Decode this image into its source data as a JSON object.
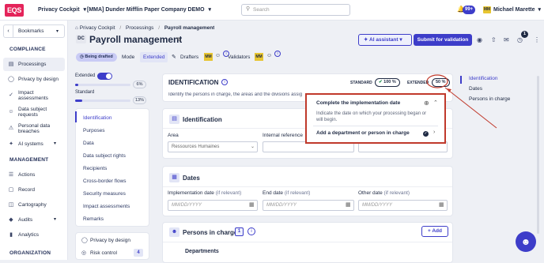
{
  "colors": {
    "accent": "#3d3dc9",
    "brand": "#e4245a",
    "status": "#1c8a4a"
  },
  "topbar": {
    "logo": "EQS",
    "product_select": "Privacy Cockpit",
    "company_select": "[MMA] Dunder Mifflin Paper Company DEMO",
    "search_placeholder": "Search",
    "notifications_badge": "99+",
    "user_initials": "MM",
    "user_name": "Michael Marette"
  },
  "sidebar": {
    "bookmarks": "Bookmarks",
    "sections": [
      {
        "title": "COMPLIANCE",
        "items": [
          {
            "label": "Processings",
            "icon": "document-icon",
            "active": true
          },
          {
            "label": "Privacy by design",
            "icon": "shield-icon"
          },
          {
            "label": "Impact assessments",
            "icon": "shield-check-icon"
          },
          {
            "label": "Data subject requests",
            "icon": "person-icon"
          },
          {
            "label": "Personal data breaches",
            "icon": "warning-icon"
          },
          {
            "label": "AI systems",
            "icon": "ai-icon",
            "expandable": true
          }
        ]
      },
      {
        "title": "MANAGEMENT",
        "items": [
          {
            "label": "Actions",
            "icon": "actions-icon"
          },
          {
            "label": "Record",
            "icon": "record-icon"
          },
          {
            "label": "Cartography",
            "icon": "map-icon"
          },
          {
            "label": "Audits",
            "icon": "audit-icon",
            "expandable": true
          },
          {
            "label": "Analytics",
            "icon": "analytics-icon"
          }
        ]
      },
      {
        "title": "ORGANIZATION",
        "items": []
      }
    ]
  },
  "breadcrumb": {
    "items": [
      "Privacy Cockpit",
      "Processings",
      "Payroll management"
    ],
    "separator": "/"
  },
  "header": {
    "avatar_initials": "DC",
    "title": "Payroll management",
    "status": "Being drafted",
    "mode_label": "Mode",
    "mode_value": "Extended",
    "drafters_label": "Drafters",
    "drafter_initials": "MM",
    "validators_label": "Validators",
    "validator_initials": "MM",
    "ai_button": "AI assistant",
    "submit_button": "Submit for validation",
    "counter_badge": "1"
  },
  "progress": {
    "extended_label": "Extended",
    "extended_percent": "6%",
    "extended_value": 0.06,
    "standard_label": "Standard",
    "standard_percent": "13%",
    "standard_value": 0.13
  },
  "section_nav": [
    "Identification",
    "Purposes",
    "Data",
    "Data subject rights",
    "Recipients",
    "Cross-border flows",
    "Security measures",
    "Impact assessments",
    "Remarks"
  ],
  "bottom_nav": [
    {
      "label": "Privacy by design"
    },
    {
      "label": "Risk control",
      "count": "4"
    }
  ],
  "identification": {
    "title": "IDENTIFICATION",
    "description": "Identify the persons in charge, the areas and the divisions assig",
    "standard_label": "STANDARD",
    "standard_pct": "100 %",
    "extended_label": "EXTENDED",
    "extended_pct": "50 %"
  },
  "popup": {
    "item1_title": "Complete the implementation date",
    "item1_desc": "Indicate the date on which your processing began or will begin.",
    "item2_title": "Add a department or person in charge"
  },
  "identification_card": {
    "title": "Identification",
    "area_label": "Area",
    "area_value": "Ressources Humaines",
    "internal_ref_label": "Internal reference"
  },
  "dates_card": {
    "title": "Dates",
    "impl_label": "Implementation date",
    "end_label": "End date",
    "other_label": "Other date",
    "if_relevant": "(if relevant)",
    "placeholder": "MM/DD/YYYY"
  },
  "persons_card": {
    "title": "Persons in charge",
    "count": "1",
    "add_button": "Add",
    "departments_label": "Departments"
  },
  "right_toc": [
    "Identification",
    "Dates",
    "Persons in charge"
  ]
}
